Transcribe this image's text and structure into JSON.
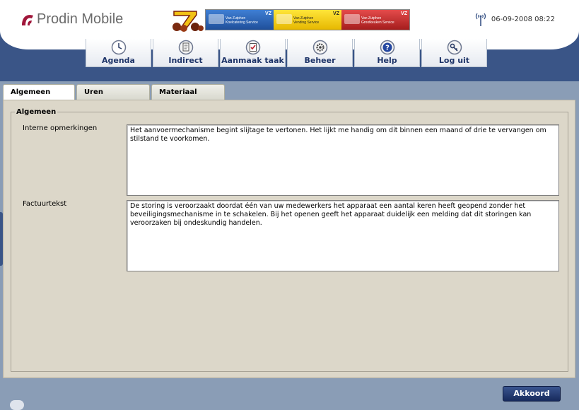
{
  "app": {
    "name": "Prodin Mobile"
  },
  "status": {
    "datetime": "06-09-2008 08:22",
    "icon": "antenna-icon"
  },
  "banner": {
    "segments": [
      {
        "name": "Van Zutphen Koelcatering Service",
        "line1": "Van Zutphen",
        "line2": "Koelcatering Service",
        "color": "#2f6ac0"
      },
      {
        "name": "Van Zutphen Vending Service",
        "line1": "Van Zutphen",
        "line2": "Vending Service",
        "color": "#f5d21c"
      },
      {
        "name": "Van Zutphen Grootkeuken Service",
        "line1": "Van Zutphen",
        "line2": "Grootkeuken Service",
        "color": "#c83232"
      }
    ],
    "badge": "VZ"
  },
  "nav": {
    "items": [
      {
        "label": "Agenda",
        "icon": "clock-icon"
      },
      {
        "label": "Indirect",
        "icon": "document-icon"
      },
      {
        "label": "Aanmaak taak",
        "icon": "checklist-icon"
      },
      {
        "label": "Beheer",
        "icon": "gear-icon"
      },
      {
        "label": "Help",
        "icon": "help-icon"
      },
      {
        "label": "Log uit",
        "icon": "key-icon"
      }
    ]
  },
  "tabs": [
    {
      "label": "Algemeen",
      "active": true
    },
    {
      "label": "Uren",
      "active": false
    },
    {
      "label": "Materiaal",
      "active": false
    }
  ],
  "form": {
    "legend": "Algemeen",
    "internal_label": "Interne opmerkingen",
    "internal_value": "Het aanvoermechanisme begint slijtage te vertonen. Het lijkt me handig om dit binnen een maand of drie te vervangen om stilstand te voorkomen.",
    "invoice_label": "Factuurtekst",
    "invoice_value": "De storing is veroorzaakt doordat één van uw medewerkers het apparaat een aantal keren heeft geopend zonder het beveiligingsmechanisme in te schakelen. Bij het openen geeft het apparaat duidelijk een melding dat dit storingen kan veroorzaken bij ondeskundig handelen."
  },
  "footer": {
    "accept_label": "Akkoord"
  },
  "colors": {
    "navy": "#3a5587",
    "panel": "#dcd7c9",
    "nav_text": "#1e3468",
    "logo_accent": "#a0163a"
  }
}
